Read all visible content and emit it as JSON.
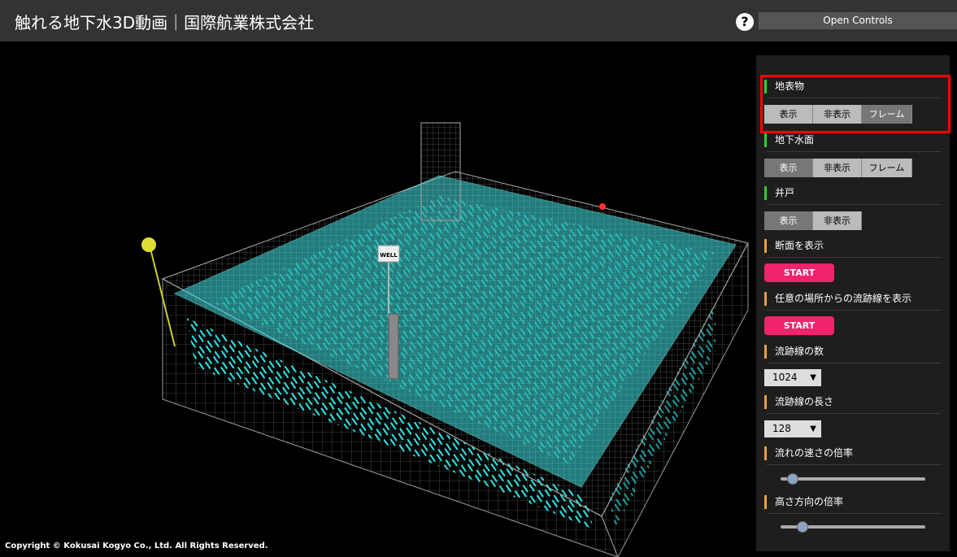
{
  "header": {
    "title": "触れる地下水3D動画｜国際航業株式会社",
    "help_label": "?",
    "open_controls_label": "Open Controls"
  },
  "viewport": {
    "well_label": "WELL",
    "copyright": "Copyright © Kokusai Kogyo Co., Ltd. All Rights Reserved."
  },
  "controls": {
    "surface": {
      "label": "地表物",
      "options": [
        "表示",
        "非表示",
        "フレーム"
      ]
    },
    "groundwater": {
      "label": "地下水面",
      "options": [
        "表示",
        "非表示",
        "フレーム"
      ]
    },
    "well": {
      "label": "井戸",
      "options": [
        "表示",
        "非表示"
      ]
    },
    "section": {
      "label": "断面を表示",
      "button": "START"
    },
    "streamline_from_point": {
      "label": "任意の場所からの流跡線を表示",
      "button": "START"
    },
    "streamline_count": {
      "label": "流跡線の数",
      "value": "1024"
    },
    "streamline_length": {
      "label": "流跡線の長さ",
      "value": "128"
    },
    "flow_speed": {
      "label": "流れの速さの倍率",
      "level": 0.05
    },
    "height_scale": {
      "label": "高さ方向の倍率",
      "level": 0.12
    }
  },
  "colors": {
    "accent_green": "#33cc33",
    "accent_orange": "#e8a040",
    "start_pink": "#f0246c",
    "water_cyan": "#40e0e0",
    "highlight_red": "#ff0000"
  }
}
